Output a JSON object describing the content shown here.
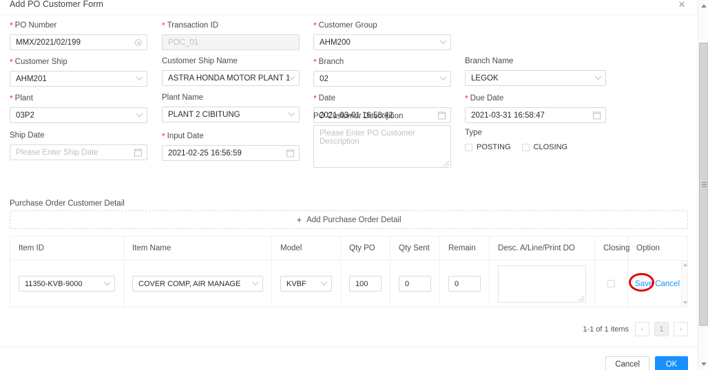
{
  "modal": {
    "title": "Add PO Customer Form",
    "close_icon": "close-icon"
  },
  "form": {
    "fields": [
      {
        "label": "PO Number",
        "required": true,
        "value": "MMX/2021/02/199",
        "placeholder": "",
        "type": "input",
        "icon": "clear-icon",
        "disabled": false
      },
      {
        "label": "Transaction ID",
        "required": true,
        "value": "",
        "placeholder": "POC_01",
        "type": "input",
        "icon": "",
        "disabled": true
      },
      {
        "label": "Customer Group",
        "required": true,
        "value": "AHM200",
        "placeholder": "",
        "type": "select",
        "icon": "chevron-down-icon",
        "disabled": false
      },
      {
        "label": "Customer Ship",
        "required": true,
        "value": "AHM201",
        "placeholder": "",
        "type": "select",
        "icon": "chevron-down-icon",
        "disabled": false
      },
      {
        "label": "Customer Ship Name",
        "required": false,
        "value": "ASTRA HONDA MOTOR PLANT 1",
        "placeholder": "",
        "type": "select",
        "icon": "chevron-down-icon",
        "disabled": false
      },
      {
        "label": "Branch",
        "required": true,
        "value": "02",
        "placeholder": "",
        "type": "select",
        "icon": "chevron-down-icon",
        "disabled": false
      },
      {
        "label": "Branch Name",
        "required": false,
        "value": "LEGOK",
        "placeholder": "",
        "type": "select",
        "icon": "chevron-down-icon",
        "disabled": false
      },
      {
        "label": "Plant",
        "required": true,
        "value": "03P2",
        "placeholder": "",
        "type": "select",
        "icon": "chevron-down-icon",
        "disabled": false
      },
      {
        "label": "Plant Name",
        "required": false,
        "value": "PLANT 2 CIBITUNG",
        "placeholder": "",
        "type": "select",
        "icon": "chevron-down-icon",
        "disabled": false
      },
      {
        "label": "Date",
        "required": true,
        "value": "2021-03-01 16:58:42",
        "placeholder": "",
        "type": "date",
        "icon": "calendar-icon",
        "disabled": false
      },
      {
        "label": "Due Date",
        "required": true,
        "value": "2021-03-31 16:58:47",
        "placeholder": "",
        "type": "date",
        "icon": "calendar-icon",
        "disabled": false
      },
      {
        "label": "Ship Date",
        "required": false,
        "value": "",
        "placeholder": "Please Enter Ship Date",
        "type": "date",
        "icon": "calendar-icon",
        "disabled": false
      },
      {
        "label": "Input Date",
        "required": true,
        "value": "2021-02-25 16:56:59",
        "placeholder": "",
        "type": "date",
        "icon": "calendar-icon",
        "disabled": false
      },
      {
        "label": "PO Customer Description",
        "required": false,
        "value": "",
        "placeholder": "Please Enter PO Customer Description",
        "type": "textarea",
        "icon": "",
        "disabled": false
      }
    ],
    "type_group": {
      "label": "Type",
      "options": [
        {
          "label": "POSTING",
          "checked": false
        },
        {
          "label": "CLOSING",
          "checked": false
        }
      ]
    }
  },
  "detail": {
    "section_title": "Purchase Order Customer Detail",
    "add_button_label": "Add Purchase Order Detail",
    "add_button_icon": "plus-icon",
    "columns": [
      "Item ID",
      "Item Name",
      "Model",
      "Qty PO",
      "Qty Sent",
      "Remain",
      "Desc. A/Line/Print DO",
      "Closing",
      "Option"
    ],
    "rows": [
      {
        "item_id": "11350-KVB-9000",
        "item_name": "COVER COMP, AIR MANAGE",
        "model": "KVBF",
        "qty_po": "100",
        "qty_sent": "0",
        "remain": "0",
        "desc": "",
        "closing": false,
        "save_label": "Save",
        "cancel_label": "Cancel"
      }
    ],
    "pagination": {
      "summary": "1-1 of 1 items",
      "prev_icon": "chevron-left-icon",
      "next_icon": "chevron-right-icon",
      "current_page": "1"
    }
  },
  "footer": {
    "cancel_label": "Cancel",
    "ok_label": "OK"
  },
  "colors": {
    "primary": "#1890ff",
    "required_star": "#f5222d",
    "annotation": "#e00000",
    "border": "#d9d9d9",
    "text": "#262626"
  }
}
